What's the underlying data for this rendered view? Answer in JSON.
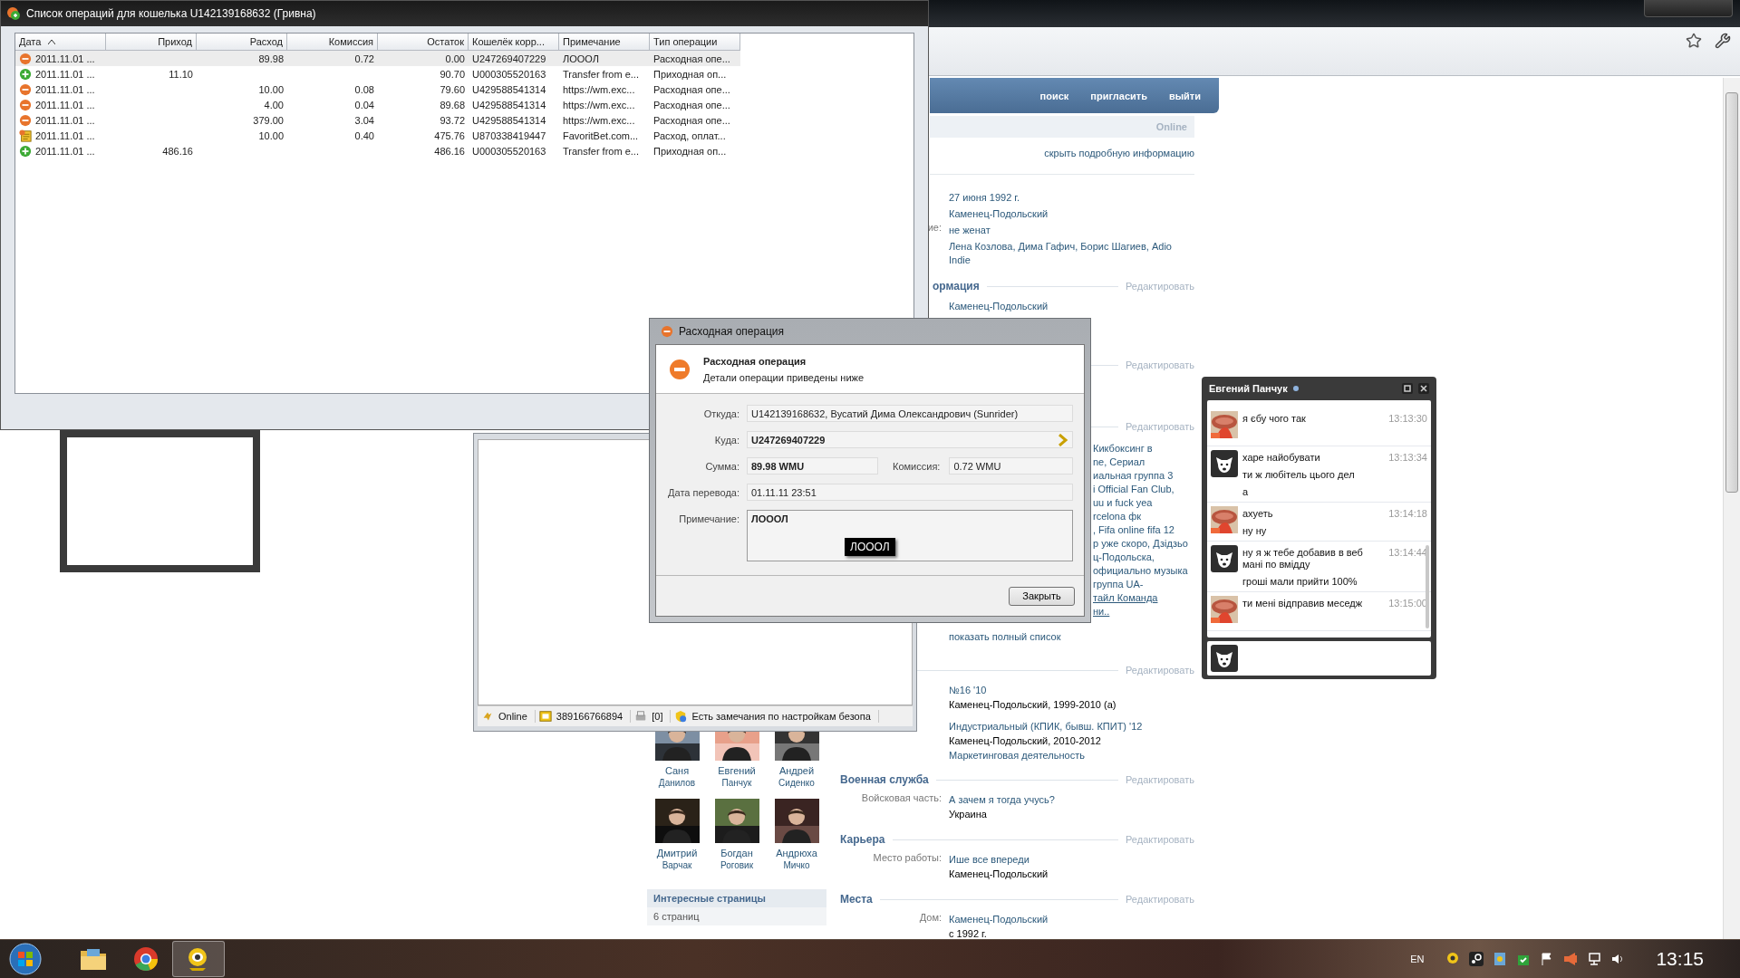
{
  "list_window": {
    "title": "Список операций для кошелька U142139168632 (Гривна)",
    "columns": [
      {
        "label": "Дата",
        "sorted": true
      },
      {
        "label": "Приход",
        "sorted": false
      },
      {
        "label": "Расход",
        "sorted": false
      },
      {
        "label": "Комиссия",
        "sorted": false
      },
      {
        "label": "Остаток",
        "sorted": false
      },
      {
        "label": "Кошелёк корр...",
        "sorted": false
      },
      {
        "label": "Примечание",
        "sorted": false
      },
      {
        "label": "Тип операции",
        "sorted": false
      }
    ],
    "rows": [
      {
        "kind": "out",
        "selected": true,
        "date": "2011.11.01 ...",
        "expense": "89.98",
        "fee": "0.72",
        "balance": "0.00",
        "wallet": "U247269407229",
        "note": "ЛОООЛ",
        "type": "Расходная опе..."
      },
      {
        "kind": "in",
        "selected": false,
        "date": "2011.11.01 ...",
        "income": "11.10",
        "balance": "90.70",
        "wallet": "U000305520163",
        "note": "Transfer from e...",
        "type": "Приходная оп..."
      },
      {
        "kind": "out",
        "selected": false,
        "date": "2011.11.01 ...",
        "expense": "10.00",
        "fee": "0.08",
        "balance": "79.60",
        "wallet": "U429588541314",
        "note": "https://wm.exc...",
        "type": "Расходная опе..."
      },
      {
        "kind": "out",
        "selected": false,
        "date": "2011.11.01 ...",
        "expense": "4.00",
        "fee": "0.04",
        "balance": "89.68",
        "wallet": "U429588541314",
        "note": "https://wm.exc...",
        "type": "Расходная опе..."
      },
      {
        "kind": "out",
        "selected": false,
        "date": "2011.11.01 ...",
        "expense": "379.00",
        "fee": "3.04",
        "balance": "93.72",
        "wallet": "U429588541314",
        "note": "https://wm.exc...",
        "type": "Расходная опе..."
      },
      {
        "kind": "bet",
        "selected": false,
        "date": "2011.11.01 ...",
        "expense": "10.00",
        "fee": "0.40",
        "balance": "475.76",
        "wallet": "U870338419447",
        "note": "FavoritBet.com...",
        "type": "Расход, оплат..."
      },
      {
        "kind": "in",
        "selected": false,
        "date": "2011.11.01 ...",
        "income": "486.16",
        "balance": "486.16",
        "wallet": "U000305520163",
        "note": "Transfer from e...",
        "type": "Приходная оп..."
      }
    ]
  },
  "vk": {
    "nav": [
      "поиск",
      "пригласить",
      "выйти"
    ],
    "status": "Online",
    "hide_details": "скрыть подробную информацию",
    "basic": [
      {
        "lines": [
          {
            "text": "27 июня 1992 г.",
            "kind": "link"
          }
        ]
      },
      {
        "lines": [
          {
            "text": "Каменец-Подольский",
            "kind": "link"
          }
        ]
      },
      {
        "label": "ие:",
        "lines": [
          {
            "text": "не женат",
            "kind": "link"
          }
        ]
      },
      {
        "lines": [
          {
            "text": "Лена Козлова, Дима Гафич, Борис Шагиев, Adio",
            "kind": "link"
          },
          {
            "text": "Indie",
            "kind": "link"
          }
        ]
      }
    ],
    "sections": [
      {
        "title": "ормация",
        "edit": "Редактировать",
        "entries": [
          {
            "lines": [
              {
                "text": "Каменец-Подольский",
                "kind": "link"
              }
            ]
          }
        ]
      },
      {
        "edit": "Редактировать"
      },
      {
        "edit": "Редактировать",
        "fragments": [
          {
            "text": "Кикбоксинг в",
            "kind": "link"
          },
          {
            "text": "ne, Сериал",
            "kind": "link"
          },
          {
            "text": "иальная группа 3",
            "kind": "link"
          },
          {
            "text": "i Official Fan Club,",
            "kind": "link"
          },
          {
            "text": "uu и fuck yea",
            "kind": "link"
          },
          {
            "text": "rcelona фк",
            "kind": "link"
          },
          {
            "text": ", Fifa online fifa 12",
            "kind": "link"
          },
          {
            "text": "р уже скоро, Дзідзьо",
            "kind": "link"
          },
          {
            "text": "ц-Подольска,",
            "kind": "link"
          },
          {
            "text": "официально музыка",
            "kind": "link"
          },
          {
            "text": "группа UA-",
            "kind": "link"
          },
          {
            "text": "тайл Команда",
            "kind": "underlined"
          },
          {
            "text": "ни..",
            "kind": "underlined"
          }
        ],
        "more": "показать полный список"
      },
      {
        "edit": "Редактировать",
        "entries": [
          {
            "lines": [
              {
                "text": "№16 '10",
                "kind": "link"
              },
              {
                "text": "Каменец-Подольский, 1999-2010 (а)",
                "kind": "text"
              }
            ]
          },
          {
            "lines": [
              {
                "text": "Индустриальный (КПИК, бывш. КПИТ) '12",
                "kind": "link"
              },
              {
                "text": "Каменец-Подольский, 2010-2012",
                "kind": "text"
              },
              {
                "text": "Маркетинговая деятельность",
                "kind": "link"
              }
            ]
          }
        ]
      },
      {
        "title": "Военная служба",
        "edit": "Редактировать",
        "entries": [
          {
            "label": "Войсковая часть:",
            "lines": [
              {
                "text": "А зачем я тогда учусь?",
                "kind": "link"
              },
              {
                "text": "Украина",
                "kind": "text"
              }
            ]
          }
        ]
      },
      {
        "title": "Карьера",
        "edit": "Редактировать",
        "entries": [
          {
            "label": "Место работы:",
            "lines": [
              {
                "text": "Ише все впереди",
                "kind": "link"
              },
              {
                "text": "Каменец-Подольский",
                "kind": "text"
              }
            ]
          }
        ]
      },
      {
        "title": "Места",
        "edit": "Редактировать",
        "entries": [
          {
            "label": "Дом:",
            "lines": [
              {
                "text": "Каменец-Подольский",
                "kind": "link"
              },
              {
                "text": "с 1992 г.",
                "kind": "text"
              }
            ]
          }
        ]
      }
    ],
    "friends": [
      {
        "first": "Саня",
        "last": "Данилов"
      },
      {
        "first": "Евгений",
        "last": "Панчук"
      },
      {
        "first": "Андрей",
        "last": "Сиденко"
      },
      {
        "first": "Дмитрий",
        "last": "Варчак"
      },
      {
        "first": "Богдан",
        "last": "Роговик"
      },
      {
        "first": "Андрюха",
        "last": "Мичко"
      }
    ],
    "pages": {
      "title": "Интересные страницы",
      "count": "6 страниц"
    }
  },
  "dialog": {
    "title": "Расходная операция",
    "heading": "Расходная операция",
    "subheading": "Детали операции приведены ниже",
    "from": {
      "label": "Откуда:",
      "value": "U142139168632, Вусатий Дима Олександрович (Sunrider)"
    },
    "to": {
      "label": "Куда:",
      "value": "U247269407229"
    },
    "amount": {
      "label": "Сумма:",
      "value": "89.98 WMU"
    },
    "fee": {
      "label": "Комиссия:",
      "value": "0.72 WMU"
    },
    "date": {
      "label": "Дата перевода:",
      "value": "01.11.11 23:51"
    },
    "note": {
      "label": "Примечание:",
      "value": "ЛОООЛ"
    },
    "tooltip": "ЛОООЛ",
    "close": "Закрыть"
  },
  "keeper": {
    "status": [
      {
        "kind": "online",
        "text": "Online"
      },
      {
        "kind": "wmid",
        "text": "389166766894"
      },
      {
        "kind": "messages",
        "text": "[0]"
      },
      {
        "kind": "security",
        "text": "Есть замечания по настройкам безопа"
      }
    ]
  },
  "chat": {
    "title": "Евгений Панчук",
    "messages": [
      {
        "kind": "friend",
        "lines": [
          "я єбу чого так"
        ],
        "time": "13:13:30"
      },
      {
        "kind": "self",
        "lines": [
          "харе найобувати",
          "ти ж любітель цього дел",
          "а"
        ],
        "time": "13:13:34"
      },
      {
        "kind": "friend",
        "lines": [
          "ахуеть",
          "ну ну"
        ],
        "time": "13:14:18"
      },
      {
        "kind": "self",
        "lines": [
          "ну я ж тебе добавив в веб мані по вмідду",
          "гроші мали прийти 100%"
        ],
        "time": "13:14:44"
      },
      {
        "kind": "friend",
        "lines": [
          "ти мені відправив меседж"
        ],
        "time": "13:15:00"
      }
    ]
  },
  "taskbar": {
    "apps": [
      {
        "kind": "explorer",
        "selected": false
      },
      {
        "kind": "chrome",
        "selected": false
      },
      {
        "kind": "webmoney",
        "selected": true
      }
    ],
    "language": "EN",
    "clock": "13:15"
  }
}
